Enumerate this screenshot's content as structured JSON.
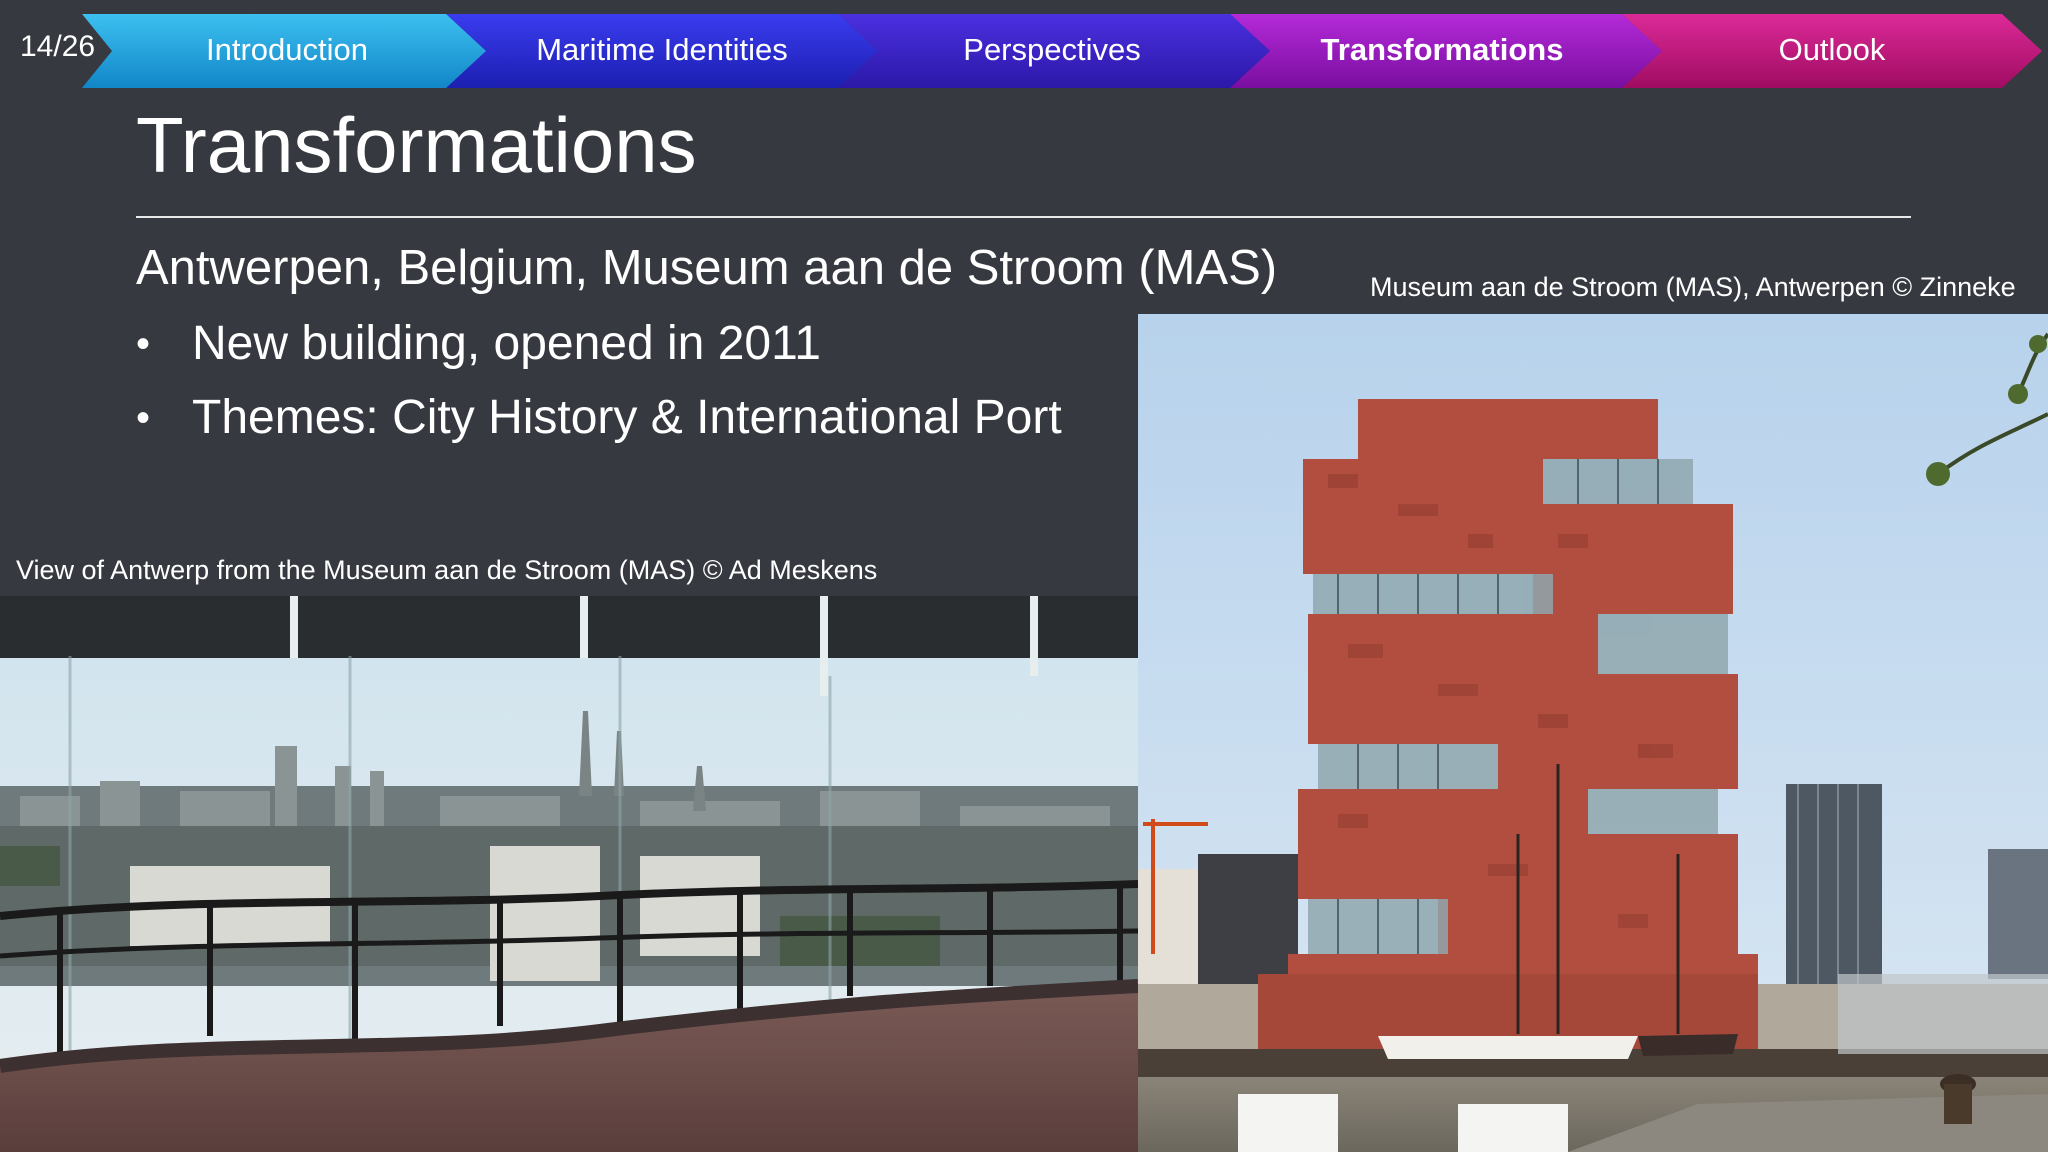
{
  "slide_counter": "14/26",
  "nav": {
    "items": [
      {
        "label": "Introduction",
        "active": false
      },
      {
        "label": "Maritime Identities",
        "active": false
      },
      {
        "label": "Perspectives",
        "active": false
      },
      {
        "label": "Transformations",
        "active": true
      },
      {
        "label": "Outlook",
        "active": false
      }
    ]
  },
  "title": "Transformations",
  "subtitle": "Antwerpen, Belgium, Museum aan de Stroom (MAS)",
  "bullets": [
    "New building, opened in 2011",
    "Themes: City History & International Port"
  ],
  "captions": {
    "left_photo": "View of Antwerp from the Museum aan de Stroom (MAS) © Ad Meskens",
    "right_photo": "Museum aan de Stroom (MAS), Antwerpen © Zinneke"
  },
  "colors": {
    "background": "#363940",
    "nav_intro": "#1fa3dc",
    "nav_maritime": "#2a2bd0",
    "nav_perspectives": "#3a22c8",
    "nav_transformations": "#9b19c0",
    "nav_outlook": "#c4137c"
  }
}
